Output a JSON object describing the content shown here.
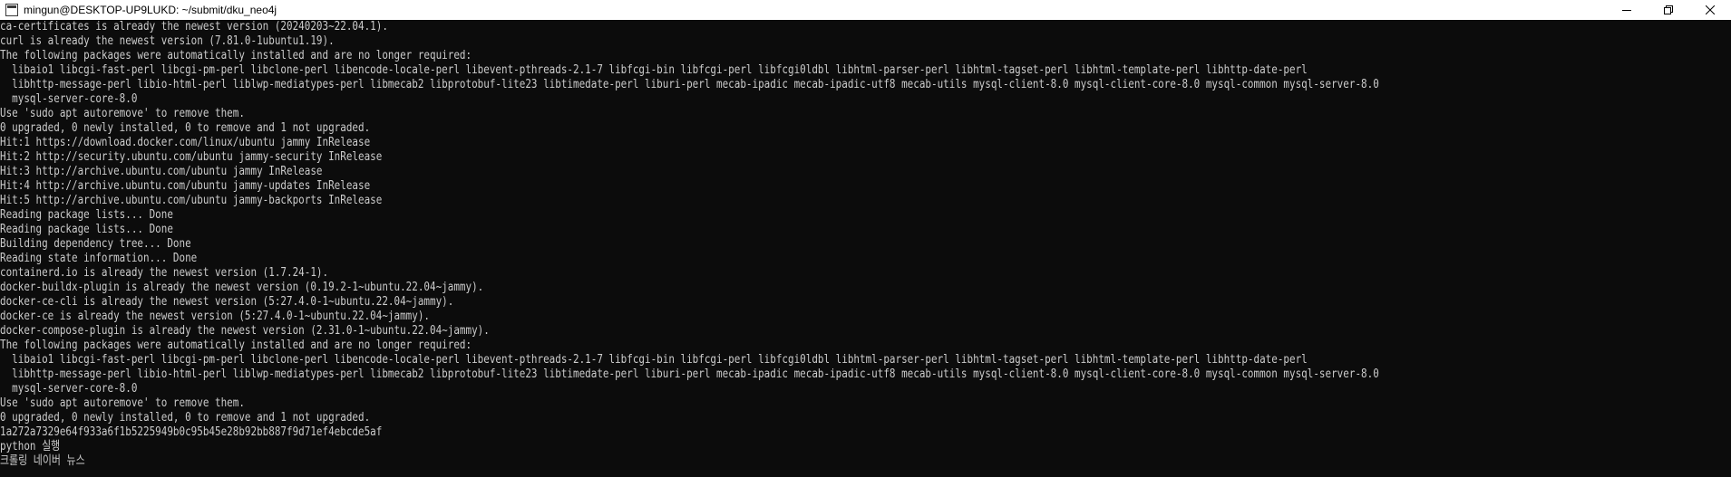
{
  "window": {
    "title": "mingun@DESKTOP-UP9LUKD: ~/submit/dku_neo4j",
    "icon": "terminal-icon"
  },
  "controls": {
    "minimize_icon": "minimize-icon",
    "restore_icon": "restore-icon",
    "close_icon": "close-icon"
  },
  "colors": {
    "background": "#0c0c0c",
    "foreground": "#cccccc",
    "titlebar": "#ffffff"
  },
  "terminal": {
    "lines": [
      "ca-certificates is already the newest version (20240203~22.04.1).",
      "curl is already the newest version (7.81.0-1ubuntu1.19).",
      "The following packages were automatically installed and are no longer required:",
      "  libaio1 libcgi-fast-perl libcgi-pm-perl libclone-perl libencode-locale-perl libevent-pthreads-2.1-7 libfcgi-bin libfcgi-perl libfcgi0ldbl libhtml-parser-perl libhtml-tagset-perl libhtml-template-perl libhttp-date-perl",
      "  libhttp-message-perl libio-html-perl liblwp-mediatypes-perl libmecab2 libprotobuf-lite23 libtimedate-perl liburi-perl mecab-ipadic mecab-ipadic-utf8 mecab-utils mysql-client-8.0 mysql-client-core-8.0 mysql-common mysql-server-8.0",
      "  mysql-server-core-8.0",
      "Use 'sudo apt autoremove' to remove them.",
      "0 upgraded, 0 newly installed, 0 to remove and 1 not upgraded.",
      "Hit:1 https://download.docker.com/linux/ubuntu jammy InRelease",
      "Hit:2 http://security.ubuntu.com/ubuntu jammy-security InRelease",
      "Hit:3 http://archive.ubuntu.com/ubuntu jammy InRelease",
      "Hit:4 http://archive.ubuntu.com/ubuntu jammy-updates InRelease",
      "Hit:5 http://archive.ubuntu.com/ubuntu jammy-backports InRelease",
      "Reading package lists... Done",
      "Reading package lists... Done",
      "Building dependency tree... Done",
      "Reading state information... Done",
      "containerd.io is already the newest version (1.7.24-1).",
      "docker-buildx-plugin is already the newest version (0.19.2-1~ubuntu.22.04~jammy).",
      "docker-ce-cli is already the newest version (5:27.4.0-1~ubuntu.22.04~jammy).",
      "docker-ce is already the newest version (5:27.4.0-1~ubuntu.22.04~jammy).",
      "docker-compose-plugin is already the newest version (2.31.0-1~ubuntu.22.04~jammy).",
      "The following packages were automatically installed and are no longer required:",
      "  libaio1 libcgi-fast-perl libcgi-pm-perl libclone-perl libencode-locale-perl libevent-pthreads-2.1-7 libfcgi-bin libfcgi-perl libfcgi0ldbl libhtml-parser-perl libhtml-tagset-perl libhtml-template-perl libhttp-date-perl",
      "  libhttp-message-perl libio-html-perl liblwp-mediatypes-perl libmecab2 libprotobuf-lite23 libtimedate-perl liburi-perl mecab-ipadic mecab-ipadic-utf8 mecab-utils mysql-client-8.0 mysql-client-core-8.0 mysql-common mysql-server-8.0",
      "  mysql-server-core-8.0",
      "Use 'sudo apt autoremove' to remove them.",
      "0 upgraded, 0 newly installed, 0 to remove and 1 not upgraded.",
      "1a272a7329e64f933a6f1b5225949b0c95b45e28b92bb887f9d71ef4ebcde5af",
      "python 실행",
      "크롤링 네이버 뉴스"
    ]
  }
}
